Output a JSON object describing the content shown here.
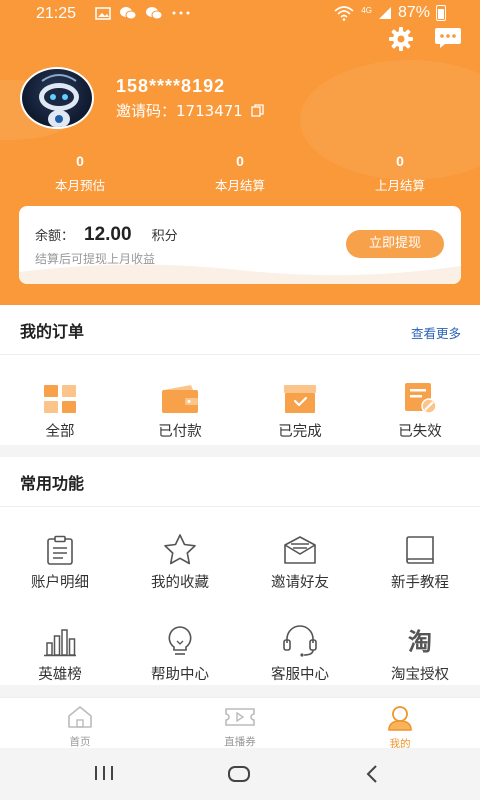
{
  "status_bar": {
    "time": "21:25",
    "battery": "87%",
    "network": "4G"
  },
  "profile": {
    "phone": "158****8192",
    "invite_label": "邀请码：",
    "invite_code": "1713471"
  },
  "stats": [
    {
      "value": "0",
      "label": "本月预估"
    },
    {
      "value": "0",
      "label": "本月结算"
    },
    {
      "value": "0",
      "label": "上月结算"
    }
  ],
  "balance": {
    "label": "余额：",
    "amount": "12.00",
    "unit": "积分",
    "note": "结算后可提现上月收益",
    "withdraw_label": "立即提现"
  },
  "orders": {
    "title": "我的订单",
    "more": "查看更多",
    "items": [
      {
        "label": "全部",
        "icon": "grid-icon"
      },
      {
        "label": "已付款",
        "icon": "wallet-icon"
      },
      {
        "label": "已完成",
        "icon": "box-check-icon"
      },
      {
        "label": "已失效",
        "icon": "doc-invalid-icon"
      }
    ]
  },
  "functions": {
    "title": "常用功能",
    "items": [
      {
        "label": "账户明细",
        "icon": "clipboard-icon"
      },
      {
        "label": "我的收藏",
        "icon": "star-icon"
      },
      {
        "label": "邀请好友",
        "icon": "mail-icon"
      },
      {
        "label": "新手教程",
        "icon": "book-icon"
      },
      {
        "label": "英雄榜",
        "icon": "bar-chart-icon"
      },
      {
        "label": "帮助中心",
        "icon": "lightbulb-icon"
      },
      {
        "label": "客服中心",
        "icon": "headset-icon"
      },
      {
        "label": "淘宝授权",
        "icon": "taobao-icon",
        "glyph": "淘"
      }
    ]
  },
  "bottom_nav": [
    {
      "label": "首页",
      "icon": "home-icon"
    },
    {
      "label": "直播券",
      "icon": "ticket-icon"
    },
    {
      "label": "我的",
      "icon": "user-icon",
      "active": true
    }
  ],
  "colors": {
    "accent": "#f9993a",
    "link": "#2a64b8",
    "button": "#f7a24b"
  }
}
